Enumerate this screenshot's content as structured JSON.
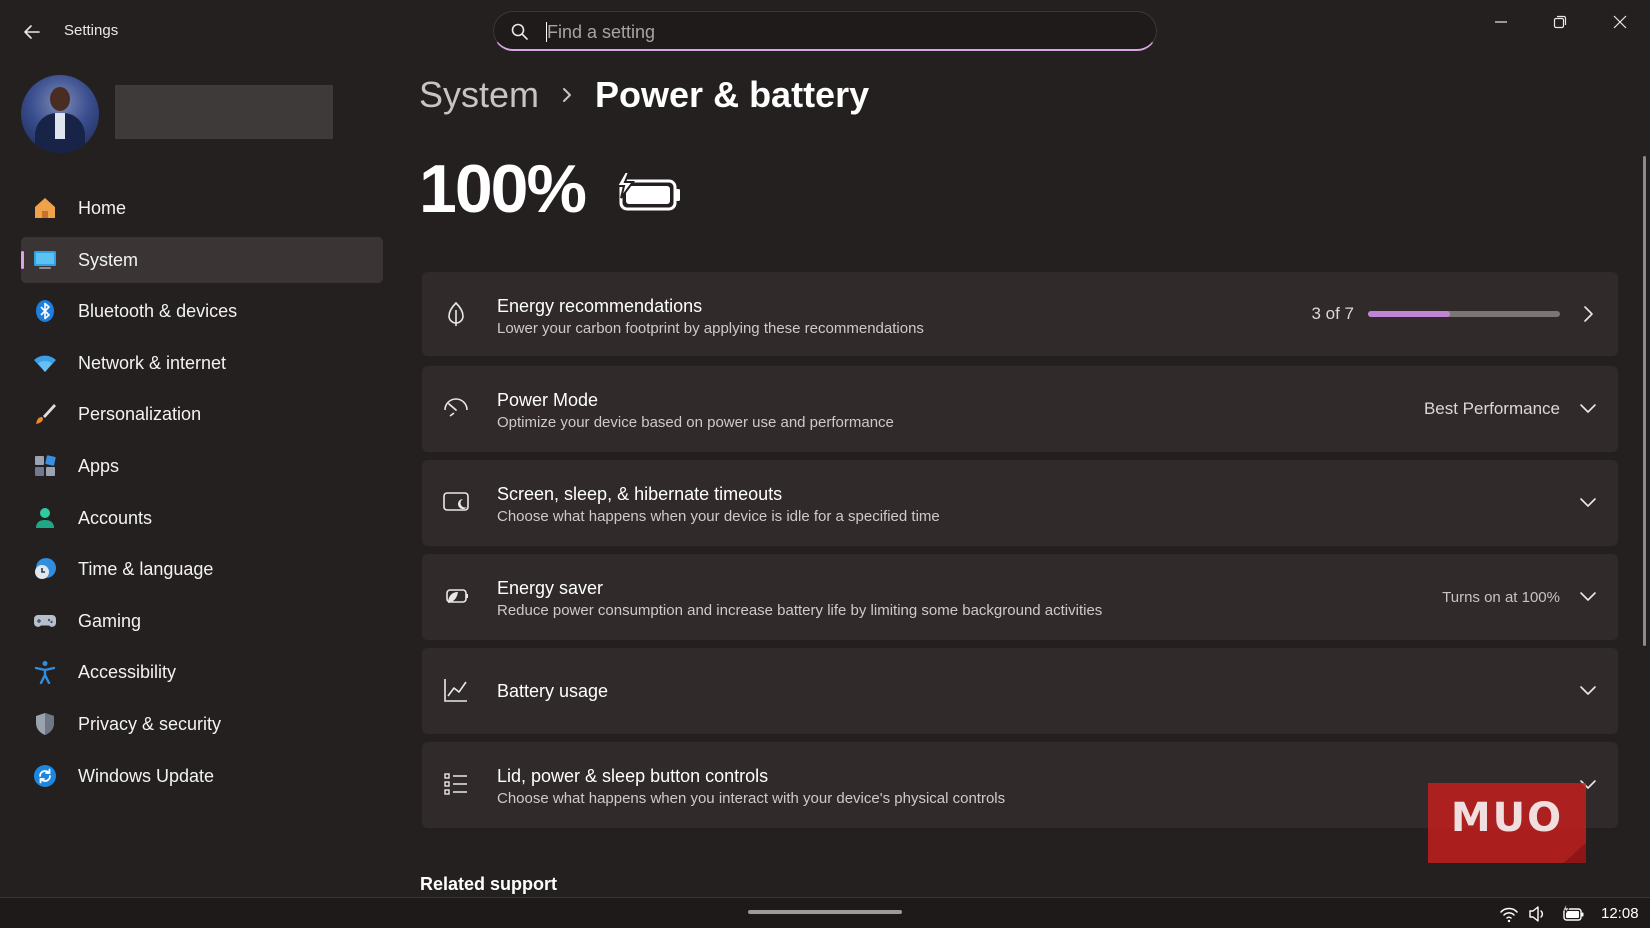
{
  "window": {
    "title": "Settings",
    "search_placeholder": "Find a setting"
  },
  "colors": {
    "accent": "#d8a4e3",
    "progress": "#c083d6",
    "background": "#252020",
    "card": "#302a2a",
    "watermark": "#c8201f"
  },
  "sidebar": {
    "items": [
      {
        "label": "Home",
        "icon": "home-icon"
      },
      {
        "label": "System",
        "icon": "system-icon",
        "active": true
      },
      {
        "label": "Bluetooth & devices",
        "icon": "bluetooth-icon"
      },
      {
        "label": "Network & internet",
        "icon": "wifi-icon"
      },
      {
        "label": "Personalization",
        "icon": "brush-icon"
      },
      {
        "label": "Apps",
        "icon": "apps-icon"
      },
      {
        "label": "Accounts",
        "icon": "accounts-icon"
      },
      {
        "label": "Time & language",
        "icon": "time-language-icon"
      },
      {
        "label": "Gaming",
        "icon": "gamepad-icon"
      },
      {
        "label": "Accessibility",
        "icon": "accessibility-icon"
      },
      {
        "label": "Privacy & security",
        "icon": "shield-icon"
      },
      {
        "label": "Windows Update",
        "icon": "update-icon"
      }
    ]
  },
  "main": {
    "breadcrumb_parent": "System",
    "breadcrumb_current": "Power & battery",
    "battery_percent": "100%",
    "cards": {
      "energy_recommendations": {
        "title": "Energy recommendations",
        "description": "Lower your carbon footprint by applying these recommendations",
        "progress_label": "3 of 7",
        "progress_fraction": 0.4286
      },
      "power_mode": {
        "title": "Power Mode",
        "description": "Optimize your device based on power use and performance",
        "value": "Best Performance"
      },
      "screen_sleep": {
        "title": "Screen, sleep, & hibernate timeouts",
        "description": "Choose what happens when your device is idle for a specified time"
      },
      "energy_saver": {
        "title": "Energy saver",
        "description": "Reduce power consumption and increase battery life by limiting some background activities",
        "value": "Turns on at 100%"
      },
      "battery_usage": {
        "title": "Battery usage"
      },
      "lid_power": {
        "title": "Lid, power & sleep button controls",
        "description": "Choose what happens when you interact with your device's physical controls"
      }
    },
    "related_support": "Related support"
  },
  "watermark": {
    "text": "MUO"
  },
  "taskbar": {
    "time": "12:08"
  }
}
